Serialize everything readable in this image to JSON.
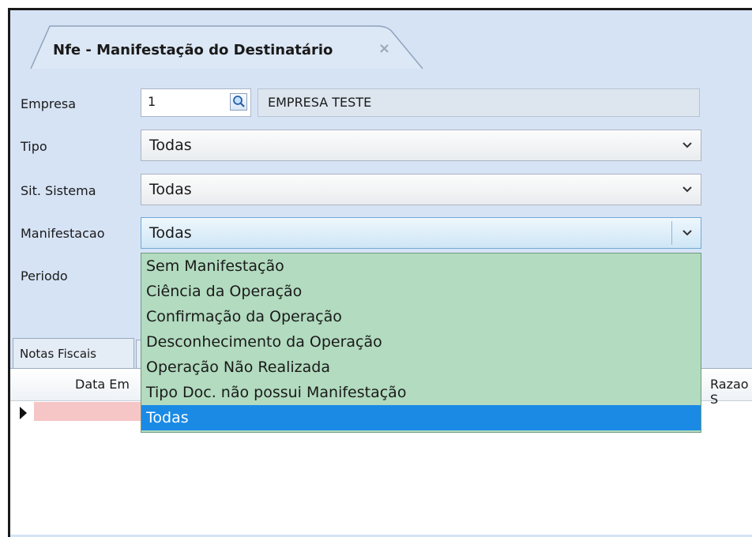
{
  "window": {
    "tab_title": "Nfe - Manifestação do Destinatário",
    "tab_close": "×"
  },
  "form": {
    "empresa": {
      "label": "Empresa",
      "code": "1",
      "name": "EMPRESA TESTE"
    },
    "tipo": {
      "label": "Tipo",
      "value": "Todas"
    },
    "sit_sistema": {
      "label": "Sit. Sistema",
      "value": "Todas"
    },
    "manifestacao": {
      "label": "Manifestacao",
      "value": "Todas"
    },
    "periodo": {
      "label": "Periodo"
    }
  },
  "dropdown": {
    "options": [
      "Sem Manifestação",
      "Ciência da Operação",
      "Confirmação da Operação",
      "Desconhecimento da Operação",
      "Operação Não Realizada",
      "Tipo Doc. não possui Manifestação",
      "Todas"
    ],
    "selected_index": 6
  },
  "bottom": {
    "tab_label": "Notas Fiscais",
    "grid_columns": [
      "Data Em",
      "Razao S"
    ]
  },
  "colors": {
    "dropdown_bg": "#b2dbbf",
    "selected_bg": "#1a8ae5",
    "frame_bg": "#d6e3f5",
    "row_highlight": "#f6c6c6"
  },
  "icons": {
    "lookup": "magnifier-icon",
    "chevron": "chevron-down-icon",
    "close": "close-icon",
    "row_pointer": "row-indicator-icon"
  }
}
